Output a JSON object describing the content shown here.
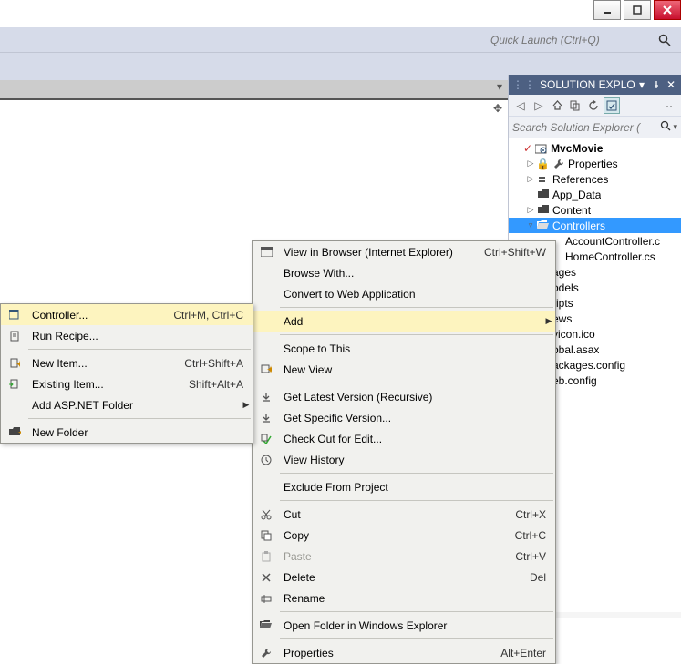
{
  "quicklaunch": {
    "placeholder": "Quick Launch (Ctrl+Q)"
  },
  "panel": {
    "title": "SOLUTION EXPLO...",
    "search_placeholder": "Search Solution Explorer ("
  },
  "tree": {
    "root": "MvcMovie",
    "items": [
      {
        "indent": 1,
        "arrow": "▷",
        "icon": "wrench",
        "label": "Properties"
      },
      {
        "indent": 1,
        "arrow": "▷",
        "icon": "refs",
        "label": "References"
      },
      {
        "indent": 1,
        "arrow": "",
        "icon": "folder",
        "label": "App_Data"
      },
      {
        "indent": 1,
        "arrow": "▷",
        "icon": "folder",
        "label": "Content"
      },
      {
        "indent": 1,
        "arrow": "▿",
        "icon": "folder-open",
        "label": "Controllers",
        "selected": true
      },
      {
        "indent": 2,
        "arrow": "",
        "icon": "",
        "label": "AccountController.c"
      },
      {
        "indent": 2,
        "arrow": "",
        "icon": "",
        "label": "HomeController.cs"
      },
      {
        "indent": 1,
        "arrow": "",
        "icon": "",
        "label": "ages"
      },
      {
        "indent": 1,
        "arrow": "",
        "icon": "",
        "label": "odels"
      },
      {
        "indent": 1,
        "arrow": "",
        "icon": "",
        "label": "ripts"
      },
      {
        "indent": 1,
        "arrow": "",
        "icon": "",
        "label": "ews"
      },
      {
        "indent": 1,
        "arrow": "",
        "icon": "",
        "label": "vicon.ico"
      },
      {
        "indent": 1,
        "arrow": "",
        "icon": "",
        "label": "obal.asax"
      },
      {
        "indent": 1,
        "arrow": "",
        "icon": "",
        "label": "ackages.config"
      },
      {
        "indent": 1,
        "arrow": "",
        "icon": "",
        "label": "eb.config"
      }
    ]
  },
  "menu1": {
    "items": [
      {
        "icon": "browser",
        "label": "View in Browser (Internet Explorer)",
        "shortcut": "Ctrl+Shift+W"
      },
      {
        "label": "Browse With..."
      },
      {
        "label": "Convert to Web Application"
      },
      {
        "sep": true
      },
      {
        "label": "Add",
        "submenu": true,
        "highlighted": true
      },
      {
        "sep": true
      },
      {
        "label": "Scope to This"
      },
      {
        "icon": "newview",
        "label": "New View"
      },
      {
        "sep": true
      },
      {
        "icon": "get",
        "label": "Get Latest Version (Recursive)"
      },
      {
        "icon": "get",
        "label": "Get Specific Version..."
      },
      {
        "icon": "checkout",
        "label": "Check Out for Edit..."
      },
      {
        "icon": "history",
        "label": "View History"
      },
      {
        "sep": true
      },
      {
        "label": "Exclude From Project"
      },
      {
        "sep": true
      },
      {
        "icon": "cut",
        "label": "Cut",
        "shortcut": "Ctrl+X"
      },
      {
        "icon": "copy",
        "label": "Copy",
        "shortcut": "Ctrl+C"
      },
      {
        "icon": "paste",
        "label": "Paste",
        "shortcut": "Ctrl+V",
        "disabled": true
      },
      {
        "icon": "delete",
        "label": "Delete",
        "shortcut": "Del"
      },
      {
        "icon": "rename",
        "label": "Rename"
      },
      {
        "sep": true
      },
      {
        "icon": "folder-open",
        "label": "Open Folder in Windows Explorer"
      },
      {
        "sep": true
      },
      {
        "icon": "wrench",
        "label": "Properties",
        "shortcut": "Alt+Enter"
      }
    ]
  },
  "menu2": {
    "items": [
      {
        "icon": "controller",
        "label": "Controller...",
        "shortcut": "Ctrl+M, Ctrl+C",
        "highlighted": true
      },
      {
        "icon": "recipe",
        "label": "Run Recipe..."
      },
      {
        "sep": true
      },
      {
        "icon": "newitem",
        "label": "New Item...",
        "shortcut": "Ctrl+Shift+A"
      },
      {
        "icon": "existitem",
        "label": "Existing Item...",
        "shortcut": "Shift+Alt+A"
      },
      {
        "label": "Add ASP.NET Folder",
        "submenu": true
      },
      {
        "sep": true
      },
      {
        "icon": "newfolder",
        "label": "New Folder"
      }
    ]
  }
}
